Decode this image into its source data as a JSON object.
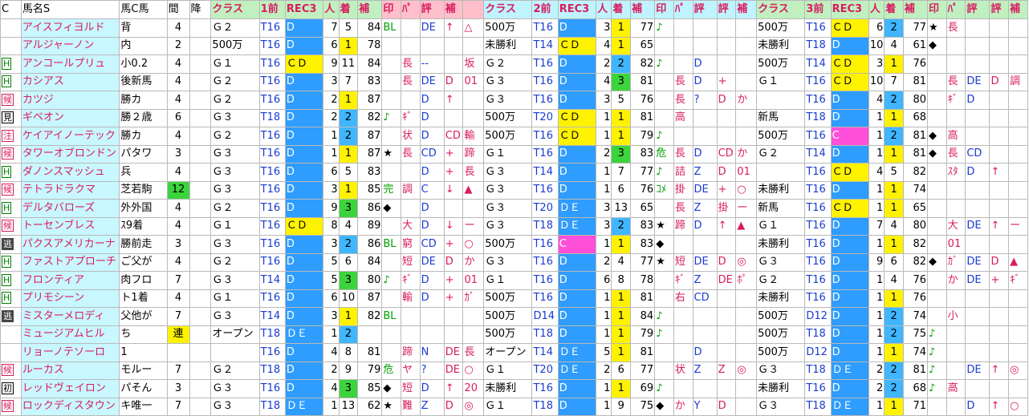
{
  "headers": {
    "c": "C",
    "name": "馬名S",
    "origin": "馬C馬",
    "interval": "間",
    "down": "降",
    "class1": "クラス",
    "p1": "1前",
    "rec1": "REC3",
    "pop1": "人",
    "rank1": "着",
    "adj1": "補",
    "mk1": "印",
    "tr1": "ﾊﾟ",
    "ev1": "評",
    "fix1": "補",
    "class2": "クラス",
    "p2": "2前",
    "rec2": "REC3",
    "pop2": "人",
    "rank2": "着",
    "adj2": "補",
    "mk2": "印",
    "tr2": "ﾊﾟ",
    "ev2": "評",
    "ev2b": "評",
    "fix2": "補",
    "class3": "クラス",
    "p3": "3前",
    "rec3": "REC3",
    "pop3": "人",
    "rank3": "着",
    "adj3": "補",
    "mk3": "印",
    "tr3": "ﾊﾟ",
    "ev3": "評",
    "ev3b": "評",
    "fix3": "補"
  },
  "rows": [
    {
      "b": "",
      "n": "アイスフィヨルド",
      "o": "背",
      "i": "4",
      "c1": "Ｇ２",
      "p1": "T16",
      "r1": "D",
      "h1": "7",
      "k1": "5",
      "a1": "84",
      "m1": "BL",
      "t1": "",
      "e1": "DE",
      "x1": "↑",
      "y1": "△",
      "c2": "500万",
      "p2": "T16",
      "r2": "D",
      "h2": "3",
      "k2": "1",
      "a2": "77",
      "m2": "♪",
      "t2": "",
      "e2": "",
      "x2": "",
      "y2": "",
      "c3": "500万",
      "p3": "T16",
      "r3": "ＣＤ",
      "h3": "6",
      "k3": "2",
      "a3": "77",
      "m3": "★",
      "t3": "長",
      "e3": "",
      "x3": "",
      "y3": ""
    },
    {
      "b": "",
      "n": "アルジャーノン",
      "o": "内",
      "i": "2",
      "c1": "500万",
      "p1": "T16",
      "r1": "D",
      "h1": "6",
      "k1": "1",
      "a1": "78",
      "m1": "",
      "t1": "",
      "e1": "",
      "x1": "",
      "y1": "",
      "c2": "未勝利",
      "p2": "T14",
      "r2": "ＣＤ",
      "h2": "4",
      "k2": "1",
      "a2": "65",
      "m2": "",
      "t2": "",
      "e2": "",
      "x2": "",
      "y2": "",
      "c3": "未勝利",
      "p3": "T18",
      "r3": "D",
      "h3": "10",
      "k3": "4",
      "a3": "61",
      "m3": "◆",
      "t3": "",
      "e3": "",
      "x3": "",
      "y3": ""
    },
    {
      "b": "H",
      "n": "アンコールプリュ",
      "o": "小0.2",
      "i": "4",
      "c1": "Ｇ１",
      "p1": "T16",
      "r1": "ＣＤ",
      "h1": "9",
      "k1": "11",
      "a1": "84",
      "m1": "",
      "t1": "長",
      "e1": "--",
      "x1": "",
      "y1": "坂",
      "c2": "Ｇ２",
      "p2": "T16",
      "r2": "D",
      "h2": "2",
      "k2": "2",
      "a2": "82",
      "m2": "♪",
      "t2": "",
      "e2": "D",
      "x2": "",
      "y2": "",
      "c3": "500万",
      "p3": "T14",
      "r3": "ＣＤ",
      "h3": "3",
      "k3": "1",
      "a3": "76",
      "m3": "",
      "t3": "",
      "e3": "",
      "x3": "",
      "y3": ""
    },
    {
      "b": "H",
      "n": "カシアス",
      "o": "後新馬",
      "i": "4",
      "c1": "Ｇ２",
      "p1": "T16",
      "r1": "D",
      "h1": "3",
      "k1": "7",
      "a1": "83",
      "m1": "",
      "t1": "長",
      "e1": "DE",
      "x1": "D",
      "y1": "01",
      "c2": "Ｇ３",
      "p2": "T16",
      "r2": "D",
      "h2": "4",
      "k2": "3",
      "a2": "81",
      "m2": "",
      "t2": "長",
      "e2": "D",
      "x2": "+",
      "y2": "",
      "c3": "Ｇ１",
      "p3": "T16",
      "r3": "ＣＤ",
      "h3": "10",
      "k3": "7",
      "a3": "81",
      "m3": "",
      "t3": "長",
      "e3": "DE",
      "x3": "D",
      "y3": "調"
    },
    {
      "b": "候",
      "n": "カツジ",
      "o": "勝カ",
      "i": "4",
      "c1": "Ｇ２",
      "p1": "T16",
      "r1": "D",
      "h1": "2",
      "k1": "1",
      "a1": "87",
      "m1": "",
      "t1": "",
      "e1": "D",
      "x1": "↑",
      "y1": "",
      "c2": "Ｇ３",
      "p2": "T16",
      "r2": "D",
      "h2": "3",
      "k2": "5",
      "a2": "76",
      "m2": "",
      "t2": "長",
      "e2": "?",
      "x2": "D",
      "y2": "か",
      "c3": "",
      "p3": "T16",
      "r3": "D",
      "h3": "4",
      "k3": "2",
      "a3": "80",
      "m3": "",
      "t3": "ｷﾞ",
      "e3": "D",
      "x3": "",
      "y3": ""
    },
    {
      "b": "見",
      "n": "ギベオン",
      "o": "勝２歳",
      "i": "6",
      "c1": "Ｇ３",
      "p1": "T18",
      "r1": "D",
      "h1": "2",
      "k1": "2",
      "a1": "82",
      "m1": "♪",
      "t1": "ｷﾞ",
      "e1": "D",
      "x1": "",
      "y1": "",
      "c2": "500万",
      "p2": "T20",
      "r2": "ＣＤ",
      "h2": "1",
      "k2": "1",
      "a2": "81",
      "m2": "",
      "t2": "高",
      "e2": "",
      "x2": "",
      "y2": "",
      "c3": "新馬",
      "p3": "T18",
      "r3": "D",
      "h3": "1",
      "k3": "1",
      "a3": "68",
      "m3": "",
      "t3": "",
      "e3": "",
      "x3": "",
      "y3": ""
    },
    {
      "b": "注",
      "n": "ケイアイノーテック",
      "o": "勝カ",
      "i": "4",
      "c1": "Ｇ２",
      "p1": "T16",
      "r1": "D",
      "h1": "1",
      "k1": "2",
      "a1": "87",
      "m1": "",
      "t1": "状",
      "e1": "D",
      "x1": "CD",
      "y1": "輸",
      "c2": "500万",
      "p2": "T16",
      "r2": "ＣＤ",
      "h2": "1",
      "k2": "1",
      "a2": "79",
      "m2": "♪",
      "t2": "",
      "e2": "",
      "x2": "",
      "y2": "",
      "c3": "500万",
      "p3": "T16",
      "r3": "C",
      "h3": "1",
      "k3": "2",
      "a3": "81",
      "m3": "◆",
      "t3": "高",
      "e3": "",
      "x3": "",
      "y3": ""
    },
    {
      "b": "候",
      "n": "タワーオブロンドン",
      "o": "パタワ",
      "i": "3",
      "c1": "Ｇ３",
      "p1": "T16",
      "r1": "D",
      "h1": "1",
      "k1": "1",
      "a1": "87",
      "m1": "★",
      "t1": "長",
      "e1": "CD",
      "x1": "+",
      "y1": "蹄",
      "c2": "Ｇ１",
      "p2": "T16",
      "r2": "D",
      "h2": "2",
      "k2": "3",
      "a2": "83",
      "m2": "危",
      "t2": "長",
      "e2": "D",
      "x2": "CD",
      "y2": "か",
      "c3": "Ｇ２",
      "p3": "T14",
      "r3": "D",
      "h3": "1",
      "k3": "1",
      "a3": "81",
      "m3": "◆",
      "t3": "長",
      "e3": "CD",
      "x3": "",
      "y3": ""
    },
    {
      "b": "H",
      "n": "ダノンスマッシュ",
      "o": "兵",
      "i": "4",
      "c1": "Ｇ３",
      "p1": "T16",
      "r1": "D",
      "h1": "6",
      "k1": "5",
      "a1": "83",
      "m1": "",
      "t1": "",
      "e1": "D",
      "x1": "+",
      "y1": "長",
      "c2": "Ｇ３",
      "p2": "T14",
      "r2": "D",
      "h2": "1",
      "k2": "7",
      "a2": "77",
      "m2": "♪",
      "t2": "詰",
      "e2": "Z",
      "x2": "D",
      "y2": "01",
      "c3": "",
      "p3": "T16",
      "r3": "ＣＤ",
      "h3": "4",
      "k3": "5",
      "a3": "82",
      "m3": "",
      "t3": "ｽﾀ",
      "e3": "D",
      "x3": "↑",
      "y3": ""
    },
    {
      "b": "候",
      "n": "テトラドラクマ",
      "o": "芝若駒",
      "i": "12",
      "c1": "Ｇ３",
      "p1": "T16",
      "r1": "D",
      "h1": "3",
      "k1": "1",
      "a1": "85",
      "m1": "完",
      "t1": "調",
      "e1": "C",
      "x1": "↓",
      "y1": "▲",
      "c2": "Ｇ３",
      "p2": "T16",
      "r2": "D",
      "h2": "1",
      "k2": "6",
      "a2": "76",
      "m2": "ｺﾒ",
      "t2": "掛",
      "e2": "DE",
      "x2": "+",
      "y2": "○",
      "c3": "未勝利",
      "p3": "T16",
      "r3": "D",
      "h3": "1",
      "k3": "1",
      "a3": "74",
      "m3": "",
      "t3": "",
      "e3": "",
      "x3": "",
      "y3": ""
    },
    {
      "b": "H",
      "n": "デルタバローズ",
      "o": "外外国",
      "i": "4",
      "c1": "Ｇ２",
      "p1": "T16",
      "r1": "D",
      "h1": "9",
      "k1": "3",
      "a1": "86",
      "m1": "◆",
      "t1": "",
      "e1": "D",
      "x1": "",
      "y1": "",
      "c2": "Ｇ３",
      "p2": "T20",
      "r2": "ＤＥ",
      "h2": "3",
      "k2": "13",
      "a2": "65",
      "m2": "",
      "t2": "長",
      "e2": "Z",
      "x2": "掛",
      "y2": "ー",
      "c3": "新馬",
      "p3": "T16",
      "r3": "ＣＤ",
      "h3": "1",
      "k3": "1",
      "a3": "65",
      "m3": "",
      "t3": "",
      "e3": "",
      "x3": "",
      "y3": ""
    },
    {
      "b": "候",
      "n": "トーセンブレス",
      "o": "ｽ9着",
      "i": "4",
      "c1": "Ｇ１",
      "p1": "T16",
      "r1": "ＣＤ",
      "h1": "8",
      "k1": "4",
      "a1": "89",
      "m1": "",
      "t1": "大",
      "e1": "D",
      "x1": "↓",
      "y1": "ー",
      "c2": "Ｇ３",
      "p2": "T18",
      "r2": "ＤＥ",
      "h2": "3",
      "k2": "2",
      "a2": "83",
      "m2": "★",
      "t2": "蹄",
      "e2": "D",
      "x2": "↑",
      "y2": "▲",
      "c3": "Ｇ１",
      "p3": "T16",
      "r3": "D",
      "h3": "7",
      "k3": "4",
      "a3": "80",
      "m3": "",
      "t3": "大",
      "e3": "DE",
      "x3": "↑",
      "y3": "ー"
    },
    {
      "b": "逃",
      "n": "パクスアメリカーナ",
      "o": "勝前走",
      "i": "3",
      "c1": "Ｇ３",
      "p1": "T16",
      "r1": "D",
      "h1": "3",
      "k1": "2",
      "a1": "86",
      "m1": "BL",
      "t1": "窮",
      "e1": "CD",
      "x1": "+",
      "y1": "○",
      "c2": "500万",
      "p2": "T16",
      "r2": "C",
      "h2": "1",
      "k2": "1",
      "a2": "83",
      "m2": "◆",
      "t2": "",
      "e2": "",
      "x2": "",
      "y2": "",
      "c3": "未勝利",
      "p3": "T16",
      "r3": "D",
      "h3": "1",
      "k3": "1",
      "a3": "82",
      "m3": "",
      "t3": "01",
      "e3": "",
      "x3": "",
      "y3": ""
    },
    {
      "b": "H",
      "n": "ファストアプローチ",
      "o": "ご父が",
      "i": "4",
      "c1": "Ｇ２",
      "p1": "T16",
      "r1": "D",
      "h1": "5",
      "k1": "6",
      "a1": "84",
      "m1": "",
      "t1": "短",
      "e1": "DE",
      "x1": "D",
      "y1": "か",
      "c2": "Ｇ３",
      "p2": "T16",
      "r2": "D",
      "h2": "2",
      "k2": "4",
      "a2": "77",
      "m2": "★",
      "t2": "短",
      "e2": "DE",
      "x2": "D",
      "y2": "◎",
      "c3": "Ｇ３",
      "p3": "T16",
      "r3": "D",
      "h3": "9",
      "k3": "6",
      "a3": "82",
      "m3": "◆",
      "t3": "ｶﾞ",
      "e3": "DE",
      "x3": "D",
      "y3": "▲"
    },
    {
      "b": "H",
      "n": "フロンティア",
      "o": "肉フロ",
      "i": "7",
      "c1": "Ｇ３",
      "p1": "T14",
      "r1": "D",
      "h1": "5",
      "k1": "3",
      "a1": "80",
      "m1": "♪",
      "t1": "ｷﾞ",
      "e1": "D",
      "x1": "+",
      "y1": "01",
      "c2": "Ｇ１",
      "p2": "T16",
      "r2": "D",
      "h2": "6",
      "k2": "8",
      "a2": "78",
      "m2": "",
      "t2": "ｷﾞ",
      "e2": "Z",
      "x2": "DE",
      "y2": "ﾎﾟ",
      "c3": "Ｇ２",
      "p3": "T16",
      "r3": "D",
      "h3": "1",
      "k3": "4",
      "a3": "76",
      "m3": "",
      "t3": "か",
      "e3": "DE",
      "x3": "+",
      "y3": "ｷﾞ"
    },
    {
      "b": "H",
      "n": "プリモシーン",
      "o": "ト1着",
      "i": "4",
      "c1": "Ｇ１",
      "p1": "T16",
      "r1": "D",
      "h1": "6",
      "k1": "10",
      "a1": "87",
      "m1": "",
      "t1": "輸",
      "e1": "D",
      "x1": "+",
      "y1": "ｶﾞ",
      "c2": "500万",
      "p2": "T16",
      "r2": "D",
      "h2": "1",
      "k2": "1",
      "a2": "81",
      "m2": "",
      "t2": "右",
      "e2": "CD",
      "x2": "",
      "y2": "",
      "c3": "未勝利",
      "p3": "T16",
      "r3": "D",
      "h3": "1",
      "k3": "1",
      "a3": "76",
      "m3": "",
      "t3": "",
      "e3": "",
      "x3": "",
      "y3": ""
    },
    {
      "b": "逃",
      "n": "ミスターメロディ",
      "o": "父他が",
      "i": "7",
      "c1": "Ｇ３",
      "p1": "T14",
      "r1": "D",
      "h1": "3",
      "k1": "1",
      "a1": "82",
      "m1": "BL",
      "t1": "",
      "e1": "",
      "x1": "",
      "y1": "",
      "c2": "500万",
      "p2": "D14",
      "r2": "D",
      "h2": "1",
      "k2": "1",
      "a2": "84",
      "m2": "♪",
      "t2": "",
      "e2": "",
      "x2": "",
      "y2": "",
      "c3": "500万",
      "p3": "D12",
      "r3": "D",
      "h3": "1",
      "k3": "2",
      "a3": "74",
      "m3": "",
      "t3": "小",
      "e3": "",
      "x3": "",
      "y3": ""
    },
    {
      "b": "",
      "n": "ミュージアムヒル",
      "o": "ち",
      "i": "連",
      "c1": "オープン",
      "p1": "T18",
      "r1": "ＤＥ",
      "h1": "1",
      "k1": "2",
      "a1": "",
      "m1": "",
      "t1": "",
      "e1": "",
      "x1": "",
      "y1": "",
      "c2": "500万",
      "p2": "T18",
      "r2": "D",
      "h2": "1",
      "k2": "1",
      "a2": "79",
      "m2": "♪",
      "t2": "",
      "e2": "",
      "x2": "",
      "y2": "",
      "c3": "500万",
      "p3": "T18",
      "r3": "D",
      "h3": "1",
      "k3": "2",
      "a3": "75",
      "m3": "♪",
      "t3": "",
      "e3": "",
      "x3": "",
      "y3": ""
    },
    {
      "b": "",
      "n": "リョーノテソーロ",
      "o": "1",
      "i": "",
      "c1": "",
      "p1": "T16",
      "r1": "D",
      "h1": "4",
      "k1": "8",
      "a1": "81",
      "m1": "",
      "t1": "蹄",
      "e1": "N",
      "x1": "DE",
      "y1": "長",
      "c2": "オープン",
      "p2": "T14",
      "r2": "ＤＥ",
      "h2": "5",
      "k2": "1",
      "a2": "81",
      "m2": "",
      "t2": "",
      "e2": "D",
      "x2": "",
      "y2": "",
      "c3": "500万",
      "p3": "D12",
      "r3": "D",
      "h3": "1",
      "k3": "1",
      "a3": "74",
      "m3": "♪",
      "t3": "",
      "e3": "",
      "x3": "",
      "y3": ""
    },
    {
      "b": "候",
      "n": "ルーカス",
      "o": "モルー",
      "i": "7",
      "c1": "Ｇ２",
      "p1": "T18",
      "r1": "D",
      "h1": "2",
      "k1": "9",
      "a1": "79",
      "m1": "危",
      "t1": "ヤ",
      "e1": "?",
      "x1": "DE",
      "y1": "○",
      "c2": "Ｇ１",
      "p2": "T20",
      "r2": "ＤＥ",
      "h2": "2",
      "k2": "6",
      "a2": "77",
      "m2": "",
      "t2": "状",
      "e2": "Z",
      "x2": "Z",
      "y2": "◎",
      "c3": "Ｇ３",
      "p3": "T18",
      "r3": "ＤＥ",
      "h3": "2",
      "k3": "2",
      "a3": "81",
      "m3": "♪",
      "t3": "",
      "e3": "DE",
      "x3": "↑",
      "y3": "◎"
    },
    {
      "b": "初",
      "n": "レッドヴェイロン",
      "o": "パそん",
      "i": "3",
      "c1": "Ｇ３",
      "p1": "T16",
      "r1": "D",
      "h1": "4",
      "k1": "3",
      "a1": "85",
      "m1": "◆",
      "t1": "短",
      "e1": "D",
      "x1": "↑",
      "y1": "20",
      "c2": "未勝利",
      "p2": "T16",
      "r2": "D",
      "h2": "1",
      "k2": "1",
      "a2": "69",
      "m2": "♪",
      "t2": "",
      "e2": "",
      "x2": "",
      "y2": "",
      "c3": "未勝利",
      "p3": "T16",
      "r3": "D",
      "h3": "2",
      "k3": "2",
      "a3": "68",
      "m3": "♪",
      "t3": "高",
      "e3": "",
      "x3": "",
      "y3": ""
    },
    {
      "b": "候",
      "n": "ロックディスタウン",
      "o": "キ唯一",
      "i": "7",
      "c1": "Ｇ３",
      "p1": "T18",
      "r1": "ＤＥ",
      "h1": "1",
      "k1": "13",
      "a1": "62",
      "m1": "★",
      "t1": "難",
      "e1": "Z",
      "x1": "D",
      "y1": "◎",
      "c2": "Ｇ１",
      "p2": "T18",
      "r2": "D",
      "h2": "1",
      "k2": "9",
      "a2": "75",
      "m2": "◆",
      "t2": "か",
      "e2": "Y",
      "x2": "D",
      "y2": "",
      "c3": "Ｇ３",
      "p3": "T18",
      "r3": "ＤＥ",
      "h3": "1",
      "k3": "1",
      "a3": "71",
      "m3": "",
      "t3": "",
      "e3": "D",
      "x3": "↑",
      "y3": "○"
    }
  ]
}
